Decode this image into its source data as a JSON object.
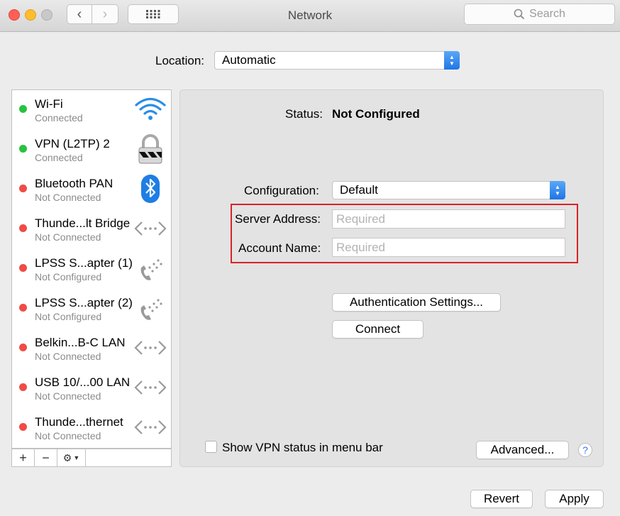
{
  "window": {
    "title": "Network"
  },
  "toolbar": {
    "search_placeholder": "Search"
  },
  "location": {
    "label": "Location:",
    "value": "Automatic"
  },
  "services": [
    {
      "name": "Wi-Fi",
      "status": "Connected",
      "dot_color": "#29c13f",
      "icon": "wifi-icon"
    },
    {
      "name": "VPN (L2TP) 2",
      "status": "Connected",
      "dot_color": "#29c13f",
      "icon": "vpn-lock-icon"
    },
    {
      "name": "Bluetooth PAN",
      "status": "Not Connected",
      "dot_color": "#f04b45",
      "icon": "bluetooth-icon"
    },
    {
      "name": "Thunde...lt Bridge",
      "status": "Not Connected",
      "dot_color": "#f04b45",
      "icon": "ethernet-icon"
    },
    {
      "name": "LPSS S...apter (1)",
      "status": "Not Configured",
      "dot_color": "#f04b45",
      "icon": "phone-icon"
    },
    {
      "name": "LPSS S...apter (2)",
      "status": "Not Configured",
      "dot_color": "#f04b45",
      "icon": "phone-icon"
    },
    {
      "name": "Belkin...B-C LAN",
      "status": "Not Connected",
      "dot_color": "#f04b45",
      "icon": "ethernet-icon"
    },
    {
      "name": "USB 10/...00 LAN",
      "status": "Not Connected",
      "dot_color": "#f04b45",
      "icon": "ethernet-icon"
    },
    {
      "name": "Thunde...thernet",
      "status": "Not Connected",
      "dot_color": "#f04b45",
      "icon": "ethernet-icon"
    }
  ],
  "sidebar_footer": {
    "add": "+",
    "remove": "−"
  },
  "detail": {
    "status_label": "Status:",
    "status_value": "Not Configured",
    "configuration_label": "Configuration:",
    "configuration_value": "Default",
    "server_label": "Server Address:",
    "server_placeholder": "Required",
    "account_label": "Account Name:",
    "account_placeholder": "Required",
    "auth_button": "Authentication Settings...",
    "connect_button": "Connect",
    "show_vpn_label": "Show VPN status in menu bar",
    "show_vpn_checked": false,
    "advanced_button": "Advanced...",
    "help": "?"
  },
  "footer": {
    "revert_button": "Revert",
    "apply_button": "Apply"
  },
  "colors": {
    "accent": "#1f75e6",
    "highlight_box": "#d9222a"
  }
}
